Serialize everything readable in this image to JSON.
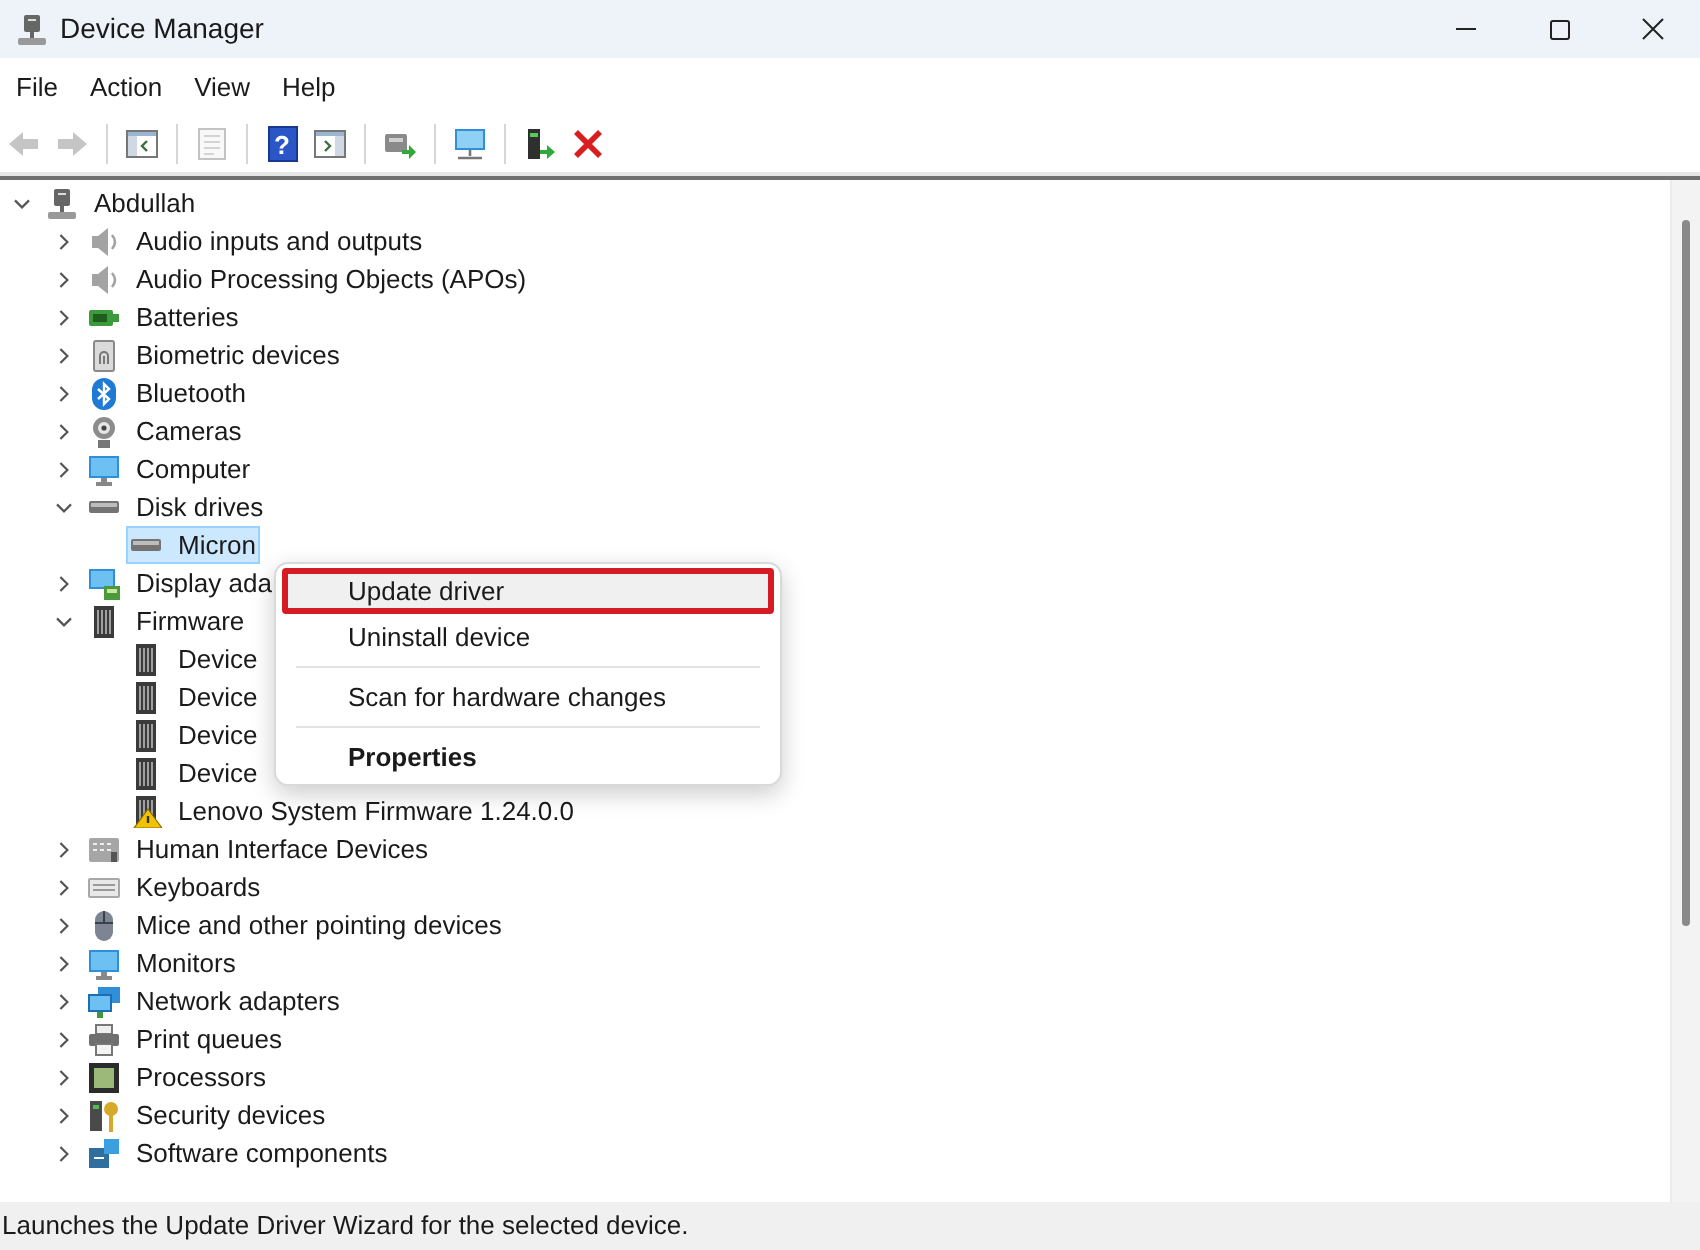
{
  "window": {
    "title": "Device Manager"
  },
  "menu_bar": [
    "File",
    "Action",
    "View",
    "Help"
  ],
  "toolbar": [
    {
      "kind": "back",
      "disabled": true
    },
    {
      "kind": "forward",
      "disabled": true
    },
    {
      "kind": "separator"
    },
    {
      "kind": "console_tree",
      "disabled": false
    },
    {
      "kind": "separator"
    },
    {
      "kind": "properties",
      "disabled": true
    },
    {
      "kind": "separator"
    },
    {
      "kind": "help",
      "glyph": "?",
      "disabled": false
    },
    {
      "kind": "action_pane",
      "disabled": false
    },
    {
      "kind": "separator"
    },
    {
      "kind": "update_driver",
      "disabled": false
    },
    {
      "kind": "separator"
    },
    {
      "kind": "scan",
      "disabled": false
    },
    {
      "kind": "separator"
    },
    {
      "kind": "enable",
      "disabled": false
    },
    {
      "kind": "uninstall",
      "disabled": false
    }
  ],
  "tree": {
    "label": "Abdullah",
    "kind": "computer",
    "expanded": true,
    "selected": false,
    "children": [
      {
        "label": "Audio inputs and outputs",
        "kind": "audio",
        "expanded": false,
        "selected": false
      },
      {
        "label": "Audio Processing Objects (APOs)",
        "kind": "audio",
        "expanded": false,
        "selected": false
      },
      {
        "label": "Batteries",
        "kind": "battery",
        "expanded": false,
        "selected": false
      },
      {
        "label": "Biometric devices",
        "kind": "biometric",
        "expanded": false,
        "selected": false
      },
      {
        "label": "Bluetooth",
        "kind": "bluetooth",
        "expanded": false,
        "selected": false
      },
      {
        "label": "Cameras",
        "kind": "camera",
        "expanded": false,
        "selected": false
      },
      {
        "label": "Computer",
        "kind": "monitor",
        "expanded": false,
        "selected": false
      },
      {
        "label": "Disk drives",
        "kind": "disk",
        "expanded": true,
        "selected": false,
        "children": [
          {
            "label": "Micron",
            "kind": "disk",
            "selected": true
          }
        ]
      },
      {
        "label": "Display ada",
        "kind": "display",
        "expanded": false,
        "selected": false
      },
      {
        "label": "Firmware",
        "kind": "firmware",
        "expanded": true,
        "selected": false,
        "children": [
          {
            "label": "Device",
            "kind": "firmware",
            "warning": false,
            "selected": false
          },
          {
            "label": "Device",
            "kind": "firmware",
            "warning": false,
            "selected": false
          },
          {
            "label": "Device",
            "kind": "firmware",
            "warning": false,
            "selected": false
          },
          {
            "label": "Device",
            "kind": "firmware",
            "warning": false,
            "selected": false
          },
          {
            "label": "Lenovo System Firmware 1.24.0.0",
            "kind": "firmware",
            "warning": true,
            "selected": false
          }
        ]
      },
      {
        "label": "Human Interface Devices",
        "kind": "hid",
        "expanded": false,
        "selected": false
      },
      {
        "label": "Keyboards",
        "kind": "keyboard",
        "expanded": false,
        "selected": false
      },
      {
        "label": "Mice and other pointing devices",
        "kind": "mouse",
        "expanded": false,
        "selected": false
      },
      {
        "label": "Monitors",
        "kind": "monitor",
        "expanded": false,
        "selected": false
      },
      {
        "label": "Network adapters",
        "kind": "network",
        "expanded": false,
        "selected": false
      },
      {
        "label": "Print queues",
        "kind": "printer",
        "expanded": false,
        "selected": false
      },
      {
        "label": "Processors",
        "kind": "processor",
        "expanded": false,
        "selected": false
      },
      {
        "label": "Security devices",
        "kind": "security",
        "expanded": false,
        "selected": false
      },
      {
        "label": "Software components",
        "kind": "software",
        "expanded": false,
        "selected": false
      }
    ]
  },
  "context_menu": {
    "items": [
      {
        "kind": "item",
        "label": "Update driver",
        "selected": true,
        "outlined": true,
        "default": false
      },
      {
        "kind": "item",
        "label": "Uninstall device",
        "selected": false,
        "outlined": false,
        "default": false
      },
      {
        "kind": "separator"
      },
      {
        "kind": "item",
        "label": "Scan for hardware changes",
        "selected": false,
        "outlined": false,
        "default": false
      },
      {
        "kind": "separator"
      },
      {
        "kind": "item",
        "label": "Properties",
        "selected": false,
        "outlined": false,
        "default": true
      }
    ]
  },
  "status_bar": {
    "text": "Launches the Update Driver Wizard for the selected device."
  }
}
